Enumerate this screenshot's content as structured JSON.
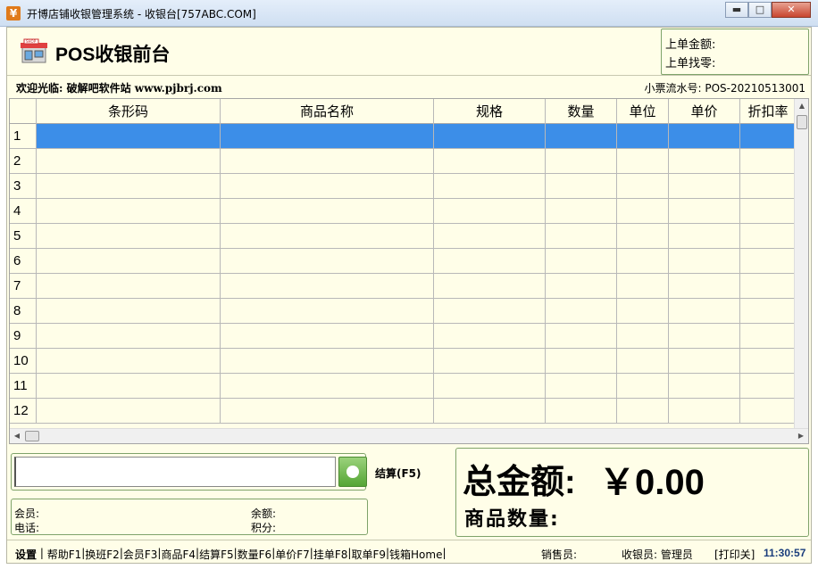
{
  "window": {
    "title": "开博店铺收银管理系统 - 收银台[757ABC.COM]",
    "icon": "yen-app-icon",
    "minimize": "▭",
    "maximize": "□",
    "close": "✕"
  },
  "header": {
    "app_title": "POS收银前台",
    "logo": "shop-icon",
    "last_amount_label": "上单金额:",
    "last_change_label": "上单找零:"
  },
  "info": {
    "welcome": "欢迎光临: 破解吧软件站 www.pjbrj.com",
    "serial": "小票流水号: POS-20210513001"
  },
  "grid": {
    "columns": [
      "条形码",
      "商品名称",
      "规格",
      "数量",
      "单位",
      "单价",
      "折扣率"
    ],
    "rows": [
      "1",
      "2",
      "3",
      "4",
      "5",
      "6",
      "7",
      "8",
      "9",
      "10",
      "11",
      "12"
    ],
    "selected_row": 1
  },
  "entry": {
    "barcode_value": "",
    "settle_label": "结算(F5)"
  },
  "member": {
    "member_label": "会员:",
    "phone_label": "电话:",
    "balance_label": "余额:",
    "points_label": "积分:"
  },
  "totals": {
    "total_label": "总金额:",
    "total_value": "￥0.00",
    "quantity_label": "商品数量:"
  },
  "status": {
    "settings": "设置",
    "fkeys": [
      "帮助F1",
      "换班F2",
      "会员F3",
      "商品F4",
      "结算F5",
      "数量F6",
      "单价F7",
      "挂单F8",
      "取单F9",
      "钱箱Home"
    ],
    "salesperson": "销售员:",
    "cashier": "收银员: 管理员",
    "print_toggle": "[打印关]",
    "clock": "11:30:57"
  },
  "colors": {
    "panel_bg": "#fffee8",
    "selected_row": "#3c8ee8",
    "box_border": "#7fa36a",
    "clock_color": "#1a3d7c"
  }
}
